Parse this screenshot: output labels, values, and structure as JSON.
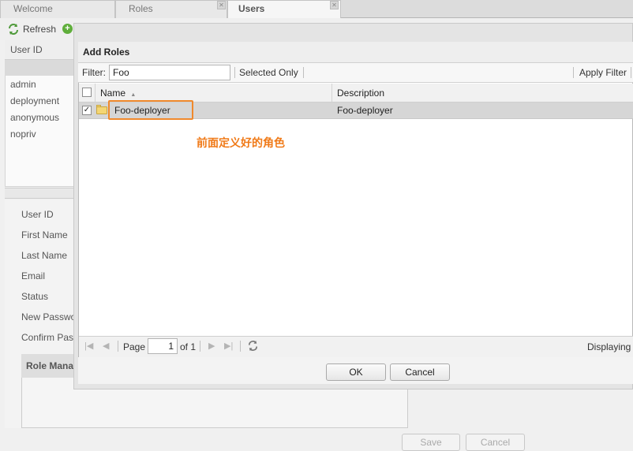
{
  "tabs": [
    {
      "label": "Welcome"
    },
    {
      "label": "Roles"
    },
    {
      "label": "Users"
    }
  ],
  "toolbar": {
    "refresh_label": "Refresh"
  },
  "users_grid": {
    "header": "User ID",
    "rows": [
      "admin",
      "deployment",
      "anonymous",
      "nopriv"
    ]
  },
  "user_form": {
    "labels": [
      "User ID",
      "First Name",
      "Last Name",
      "Email",
      "Status",
      "New Passwo",
      "Confirm Pass"
    ],
    "role_panel_title": "Role Mana",
    "save_label": "Save",
    "cancel_label": "Cancel"
  },
  "modal": {
    "title": "Add Roles",
    "filter_label": "Filter:",
    "filter_value": "Foo",
    "selected_only_label": "Selected Only",
    "apply_filter_label": "Apply Filter",
    "columns": {
      "name": "Name",
      "description": "Description"
    },
    "sort_indicator": "▲",
    "rows": [
      {
        "name": "Foo-deployer",
        "description": "Foo-deployer",
        "checked": true
      }
    ],
    "annotation": "前面定义好的角色",
    "pager": {
      "page_label": "Page",
      "page_value": "1",
      "of_label": "of 1",
      "displaying_label": "Displaying"
    },
    "ok_label": "OK",
    "cancel_label": "Cancel"
  },
  "colors": {
    "highlight": "#f0892c",
    "annotation": "#f07a18",
    "add_icon": "#5fae3b"
  }
}
